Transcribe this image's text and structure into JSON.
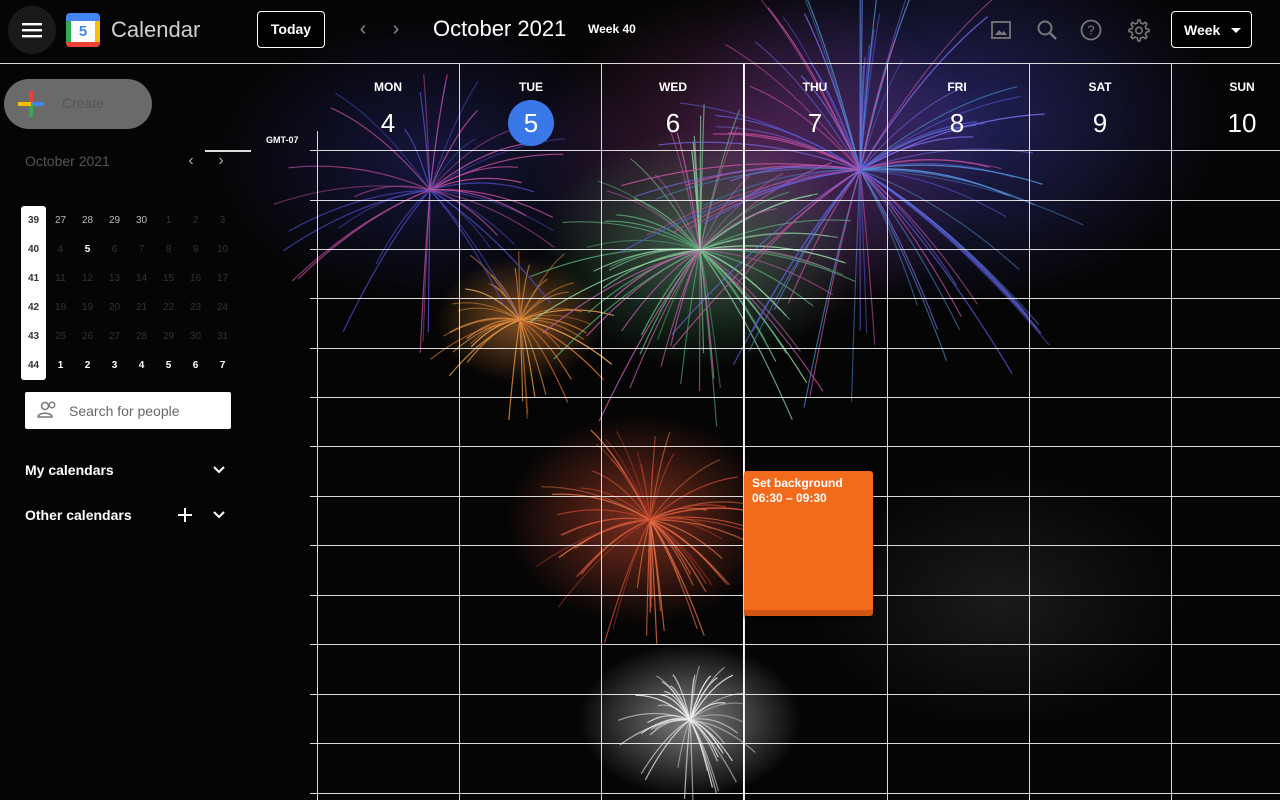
{
  "header": {
    "app_title": "Calendar",
    "logo_number": "5",
    "today_label": "Today",
    "month_title": "October 2021",
    "week_label": "Week 40",
    "view_selector": "Week",
    "icons": [
      "menu-icon",
      "previous-week-icon",
      "next-week-icon",
      "image-icon",
      "search-icon",
      "help-icon",
      "settings-icon"
    ]
  },
  "sidebar": {
    "create_label": "Create",
    "mini_month_title": "October 2021",
    "week_numbers": [
      "39",
      "40",
      "41",
      "42",
      "43",
      "44"
    ],
    "mini_days": [
      [
        "27",
        "28",
        "29",
        "30",
        "1",
        "2",
        "3"
      ],
      [
        "4",
        "5",
        "6",
        "7",
        "8",
        "9",
        "10"
      ],
      [
        "11",
        "12",
        "13",
        "14",
        "15",
        "16",
        "17"
      ],
      [
        "18",
        "19",
        "20",
        "21",
        "22",
        "23",
        "24"
      ],
      [
        "25",
        "26",
        "27",
        "28",
        "29",
        "30",
        "31"
      ],
      [
        "1",
        "2",
        "3",
        "4",
        "5",
        "6",
        "7"
      ]
    ],
    "mini_selected_day": "5",
    "search_placeholder": "Search for people",
    "my_calendars": "My calendars",
    "other_calendars": "Other calendars"
  },
  "grid": {
    "timezone": "GMT-07",
    "days": [
      {
        "name": "MON",
        "num": "4"
      },
      {
        "name": "TUE",
        "num": "5",
        "today": true
      },
      {
        "name": "WED",
        "num": "6"
      },
      {
        "name": "THU",
        "num": "7"
      },
      {
        "name": "FRI",
        "num": "8"
      },
      {
        "name": "SAT",
        "num": "9"
      },
      {
        "name": "SUN",
        "num": "10"
      }
    ],
    "event": {
      "title": "Set background",
      "time": "06:30 – 09:30",
      "color": "#f26b1d"
    },
    "today_color": "#3b78e7"
  }
}
